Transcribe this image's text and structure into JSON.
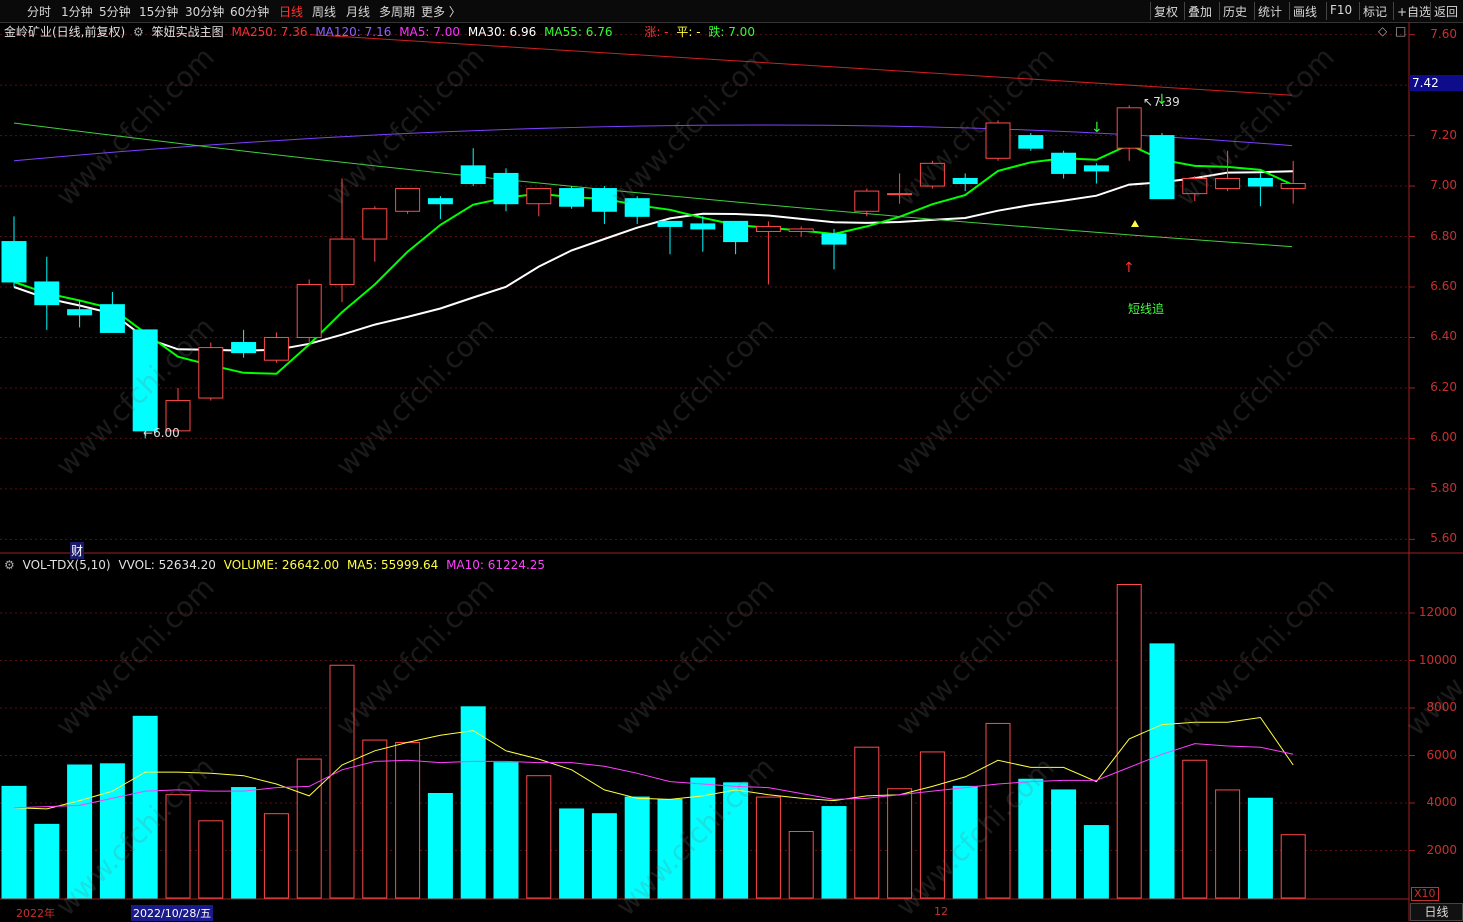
{
  "toolbar": {
    "periods": [
      "分时",
      "1分钟",
      "5分钟",
      "15分钟",
      "30分钟",
      "60分钟",
      "日线",
      "周线",
      "月线",
      "多周期",
      "更多 〉"
    ],
    "active_period": "日线",
    "right_tools": [
      "复权",
      "叠加",
      "历史",
      "统计",
      "画线",
      "F10",
      "标记",
      "+自选",
      "返回"
    ]
  },
  "legend_main": {
    "stock": "金岭矿业(日线,前复权)",
    "indicator": "笨妞实战主图",
    "ma250": "MA250: 7.36",
    "ma120": "MA120: 7.16",
    "ma5": "MA5: 7.00",
    "ma30": "MA30: 6.96",
    "ma55": "MA55: 6.76",
    "up": "涨: -",
    "flat": "平: -",
    "down": "跌: 7.00"
  },
  "legend_vol": {
    "name": "VOL-TDX(5,10)",
    "vvol": "VVOL: 52634.20",
    "volume": "VOLUME: 26642.00",
    "ma5": "MA5: 55999.64",
    "ma10": "MA10: 61224.25"
  },
  "price_axis": [
    "7.60",
    "7.40",
    "7.20",
    "7.00",
    "6.80",
    "6.60",
    "6.40",
    "6.20",
    "6.00",
    "5.80",
    "5.60"
  ],
  "current_price": "7.42",
  "vol_axis": [
    "12000",
    "10000",
    "8000",
    "6000",
    "4000",
    "2000"
  ],
  "annotations": {
    "high": "7.39",
    "low": "6.00",
    "signal": "短线追",
    "fin": "财"
  },
  "bottom": {
    "year": "2022年",
    "date": "2022/10/28/五",
    "month12": "12",
    "day_tab": "日线",
    "x10": "X10"
  },
  "watermark": "www.cfchi.com",
  "colors": {
    "up": "#ff4a4a",
    "down": "#00ffff",
    "ma5": "#ff2020",
    "ma30": "#ffffff",
    "ma55": "#00ff00",
    "ma120": "#8040ff",
    "ma250": "#d02020",
    "vma5": "#ffff40",
    "vma10": "#ff40ff"
  },
  "chart_data": {
    "type": "candlestick",
    "ylim": [
      5.55,
      7.65
    ],
    "candles": [
      {
        "o": 6.78,
        "h": 6.88,
        "l": 6.6,
        "c": 6.62
      },
      {
        "o": 6.62,
        "h": 6.72,
        "l": 6.43,
        "c": 6.53
      },
      {
        "o": 6.51,
        "h": 6.55,
        "l": 6.44,
        "c": 6.49
      },
      {
        "o": 6.53,
        "h": 6.58,
        "l": 6.42,
        "c": 6.42
      },
      {
        "o": 6.43,
        "h": 6.43,
        "l": 6.0,
        "c": 6.03
      },
      {
        "o": 6.03,
        "h": 6.2,
        "l": 6.02,
        "c": 6.15
      },
      {
        "o": 6.16,
        "h": 6.38,
        "l": 6.15,
        "c": 6.36
      },
      {
        "o": 6.38,
        "h": 6.43,
        "l": 6.32,
        "c": 6.34
      },
      {
        "o": 6.31,
        "h": 6.42,
        "l": 6.3,
        "c": 6.4
      },
      {
        "o": 6.4,
        "h": 6.63,
        "l": 6.38,
        "c": 6.61
      },
      {
        "o": 6.61,
        "h": 7.03,
        "l": 6.54,
        "c": 6.79
      },
      {
        "o": 6.79,
        "h": 6.92,
        "l": 6.7,
        "c": 6.91
      },
      {
        "o": 6.9,
        "h": 6.99,
        "l": 6.89,
        "c": 6.99
      },
      {
        "o": 6.95,
        "h": 6.96,
        "l": 6.87,
        "c": 6.93
      },
      {
        "o": 7.08,
        "h": 7.15,
        "l": 7.0,
        "c": 7.01
      },
      {
        "o": 7.05,
        "h": 7.07,
        "l": 6.9,
        "c": 6.93
      },
      {
        "o": 6.93,
        "h": 6.99,
        "l": 6.88,
        "c": 6.99
      },
      {
        "o": 6.99,
        "h": 7.0,
        "l": 6.91,
        "c": 6.92
      },
      {
        "o": 6.99,
        "h": 7.0,
        "l": 6.85,
        "c": 6.9
      },
      {
        "o": 6.95,
        "h": 6.96,
        "l": 6.85,
        "c": 6.88
      },
      {
        "o": 6.86,
        "h": 6.86,
        "l": 6.73,
        "c": 6.84
      },
      {
        "o": 6.85,
        "h": 6.88,
        "l": 6.74,
        "c": 6.83
      },
      {
        "o": 6.86,
        "h": 6.86,
        "l": 6.73,
        "c": 6.78
      },
      {
        "o": 6.82,
        "h": 6.86,
        "l": 6.61,
        "c": 6.84
      },
      {
        "o": 6.82,
        "h": 6.84,
        "l": 6.8,
        "c": 6.83
      },
      {
        "o": 6.81,
        "h": 6.83,
        "l": 6.67,
        "c": 6.77
      },
      {
        "o": 6.9,
        "h": 6.99,
        "l": 6.88,
        "c": 6.98
      },
      {
        "o": 6.97,
        "h": 7.05,
        "l": 6.93,
        "c": 6.97
      },
      {
        "o": 7.0,
        "h": 7.1,
        "l": 6.99,
        "c": 7.09
      },
      {
        "o": 7.03,
        "h": 7.05,
        "l": 6.98,
        "c": 7.01
      },
      {
        "o": 7.11,
        "h": 7.26,
        "l": 7.1,
        "c": 7.25
      },
      {
        "o": 7.2,
        "h": 7.21,
        "l": 7.14,
        "c": 7.15
      },
      {
        "o": 7.13,
        "h": 7.14,
        "l": 7.03,
        "c": 7.05
      },
      {
        "o": 7.08,
        "h": 7.09,
        "l": 7.01,
        "c": 7.06
      },
      {
        "o": 7.15,
        "h": 7.32,
        "l": 7.1,
        "c": 7.31
      },
      {
        "o": 7.2,
        "h": 7.21,
        "l": 6.95,
        "c": 6.95
      },
      {
        "o": 6.97,
        "h": 7.04,
        "l": 6.94,
        "c": 7.03
      },
      {
        "o": 6.99,
        "h": 7.14,
        "l": 6.98,
        "c": 7.03
      },
      {
        "o": 7.03,
        "h": 7.05,
        "l": 6.92,
        "c": 7.0
      },
      {
        "o": 6.99,
        "h": 7.1,
        "l": 6.93,
        "c": 7.01
      }
    ],
    "volume": [
      4700,
      3100,
      5600,
      5650,
      7650,
      4350,
      3250,
      4650,
      3550,
      5850,
      9800,
      6650,
      6550,
      4400,
      8050,
      5700,
      5150,
      3750,
      3550,
      4250,
      4150,
      5050,
      4850,
      4250,
      2800,
      3850,
      6350,
      4600,
      6150,
      4700,
      7350,
      5000,
      4550,
      3050,
      13200,
      10700,
      5800,
      4550,
      4200,
      2664
    ],
    "vol_ma5": [
      3800,
      3750,
      4100,
      4500,
      5300,
      5300,
      5250,
      5150,
      4800,
      4300,
      5600,
      6200,
      6550,
      6850,
      7050,
      6200,
      5850,
      5400,
      4550,
      4200,
      4150,
      4300,
      4550,
      4350,
      4200,
      4100,
      4300,
      4350,
      4700,
      5100,
      5800,
      5500,
      5500,
      4900,
      6700,
      7300,
      7400,
      7400,
      7600,
      5600
    ],
    "vol_ma10": [
      3800,
      3850,
      3900,
      4200,
      4500,
      4550,
      4500,
      4500,
      4650,
      4700,
      5400,
      5750,
      5800,
      5700,
      5750,
      5750,
      5700,
      5700,
      5550,
      5250,
      4900,
      4800,
      4700,
      4650,
      4400,
      4150,
      4200,
      4350,
      4500,
      4650,
      4800,
      4900,
      4950,
      4950,
      5500,
      6050,
      6500,
      6400,
      6350,
      6050
    ],
    "vol_ylim": [
      0,
      13600
    ]
  }
}
